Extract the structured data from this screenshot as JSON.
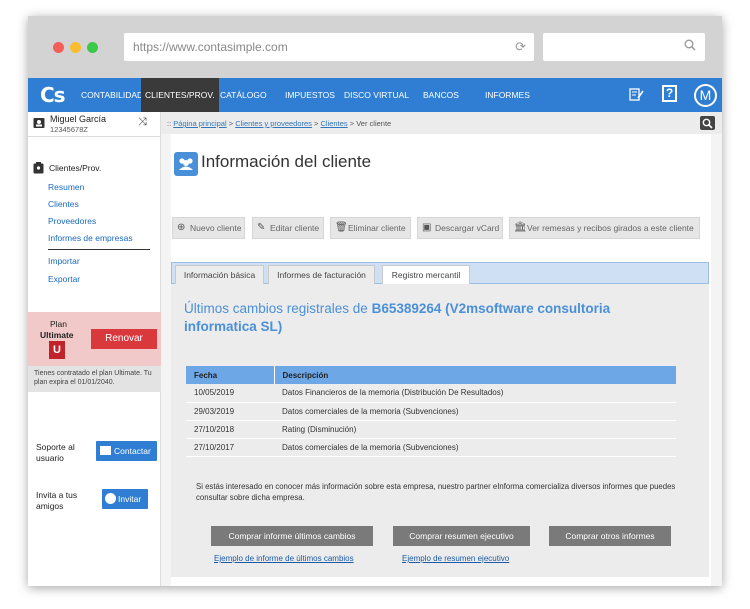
{
  "browser": {
    "url": "https://www.contasimple.com"
  },
  "topnav": {
    "logo": "Cs",
    "items": [
      "CONTABILIDAD",
      "CLIENTES/PROV.",
      "CATÁLOGO",
      "IMPUESTOS",
      "DISCO VIRTUAL",
      "BANCOS",
      "INFORMES"
    ],
    "help": "?",
    "avatar": "M",
    "bg_color": "#2f7ed3",
    "active_bg": "#3a3a3a"
  },
  "sidebar": {
    "user_name": "Miguel García",
    "user_id": "12345678Z",
    "section_title": "Clientes/Prov.",
    "links": [
      "Resumen",
      "Clientes",
      "Proveedores",
      "Informes de empresas"
    ],
    "links2": [
      "Importar",
      "Exportar"
    ],
    "plan_label": "Plan",
    "plan_name": "Ultimate",
    "plan_badge": "U",
    "renew_label": "Renovar",
    "plan_info": "Tienes contratado el plan Ultimate. Tu plan expira el 01/01/2040.",
    "support_label": "Soporte al usuario",
    "contact_label": "Contactar",
    "invite_label": "Invita a tus amigos",
    "invite_button": "Invitar"
  },
  "breadcrumb": {
    "prefix": "::",
    "items": [
      "Página principal",
      "Clientes y proveedores",
      "Clientes"
    ],
    "sep": ">",
    "current": "Ver cliente"
  },
  "main": {
    "title": "Información del cliente",
    "toolbar": [
      "Nuevo cliente",
      "Editar cliente",
      "Eliminar cliente",
      "Descargar vCard",
      "Ver remesas y recibos girados a este cliente"
    ],
    "tabs": [
      "Información básica",
      "Informes de facturación",
      "Registro mercantil"
    ],
    "active_tab": "Registro mercantil",
    "registry": {
      "title_prefix": "Últimos cambios registrales de",
      "company": "B65389264 (V2msoftware consultoria informatica SL)",
      "columns": [
        "Fecha",
        "Descripción"
      ],
      "rows": [
        {
          "date": "10/05/2019",
          "desc": "Datos Financieros de la memoria (Distribución De Resultados)"
        },
        {
          "date": "29/03/2019",
          "desc": "Datos comerciales de la memoria (Subvenciones)"
        },
        {
          "date": "27/10/2018",
          "desc": "Rating (Disminución)"
        },
        {
          "date": "27/10/2017",
          "desc": "Datos comerciales de la memoria (Subvenciones)"
        }
      ],
      "note": "Si estás interesado en conocer más información sobre esta empresa, nuestro partner eInforma comercializa diversos informes que puedes consultar sobre dicha empresa.",
      "buttons": [
        "Comprar informe últimos cambios",
        "Comprar resumen ejecutivo",
        "Comprar otros informes"
      ],
      "links": [
        "Ejemplo de informe de últimos cambios",
        "Ejemplo de resumen ejecutivo"
      ]
    }
  }
}
